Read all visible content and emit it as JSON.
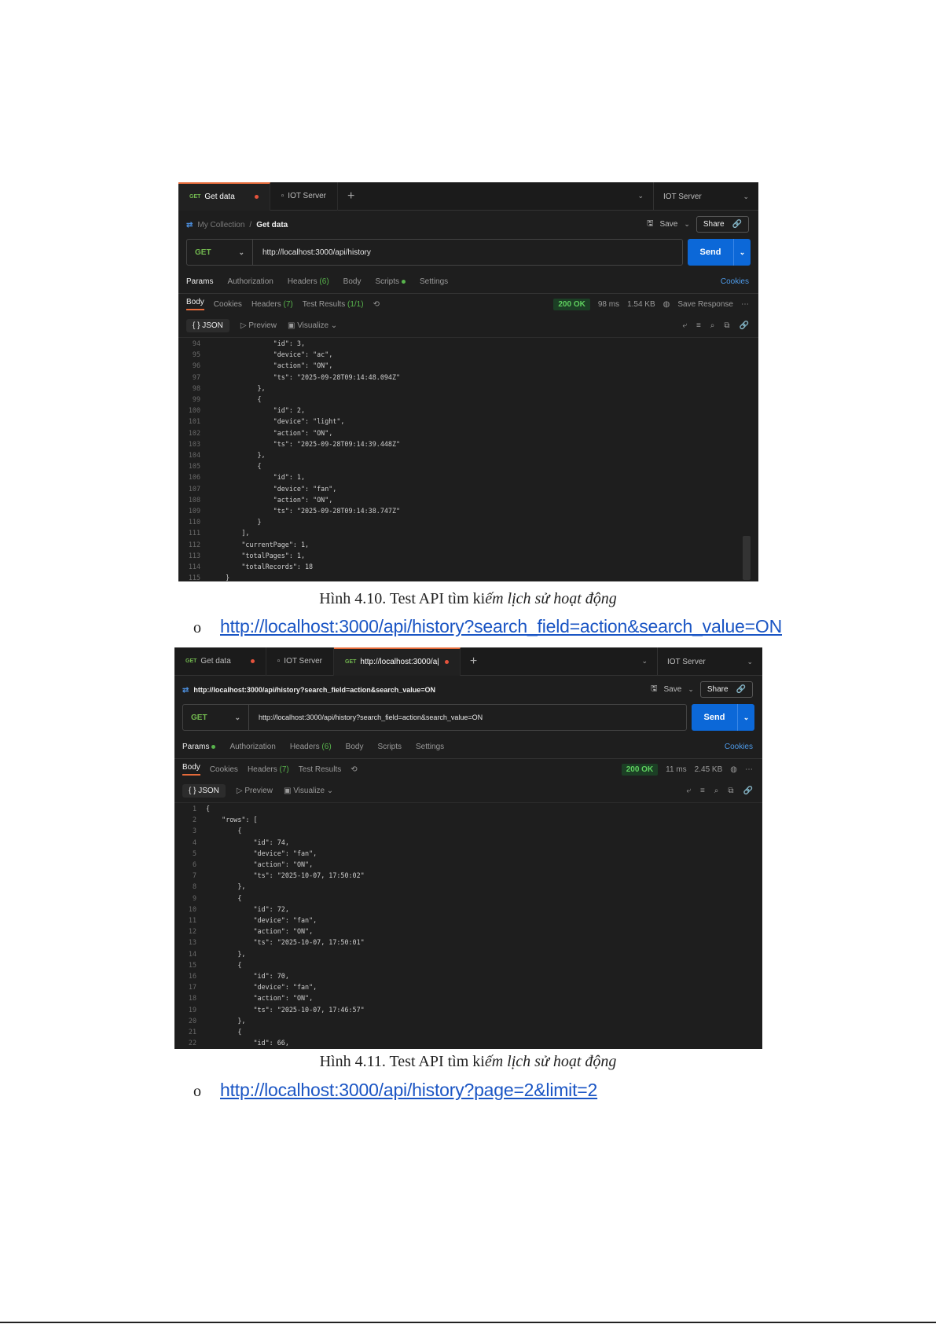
{
  "screenshot1": {
    "tabs": {
      "tab1_method": "GET",
      "tab1_label": "Get data",
      "tab2_label": "IOT Server",
      "env": "IOT Server"
    },
    "crumbs": {
      "collection": "My Collection",
      "separator": "/",
      "request": "Get data"
    },
    "actions": {
      "save": "Save",
      "share": "Share"
    },
    "url": {
      "method": "GET",
      "value": "http://localhost:3000/api/history",
      "send": "Send"
    },
    "reqtabs": {
      "params": "Params",
      "authorization": "Authorization",
      "headers": "Headers",
      "headers_count": "(6)",
      "body": "Body",
      "scripts": "Scripts",
      "settings": "Settings",
      "cookies": "Cookies"
    },
    "restabs": {
      "body": "Body",
      "cookies": "Cookies",
      "headers": "Headers",
      "headers_count": "(7)",
      "tests": "Test Results",
      "tests_count": "(1/1)"
    },
    "meta": {
      "status": "200 OK",
      "time": "98 ms",
      "size": "1.54 KB",
      "save_response": "Save Response"
    },
    "view": {
      "format": "{ } JSON",
      "preview": "Preview",
      "visualize": "Visualize"
    },
    "code": [
      {
        "n": "94",
        "t": "                \"id\": 3,"
      },
      {
        "n": "95",
        "t": "                \"device\": \"ac\","
      },
      {
        "n": "96",
        "t": "                \"action\": \"ON\","
      },
      {
        "n": "97",
        "t": "                \"ts\": \"2025-09-28T09:14:48.094Z\""
      },
      {
        "n": "98",
        "t": "            },"
      },
      {
        "n": "99",
        "t": "            {"
      },
      {
        "n": "100",
        "t": "                \"id\": 2,"
      },
      {
        "n": "101",
        "t": "                \"device\": \"light\","
      },
      {
        "n": "102",
        "t": "                \"action\": \"ON\","
      },
      {
        "n": "103",
        "t": "                \"ts\": \"2025-09-28T09:14:39.448Z\""
      },
      {
        "n": "104",
        "t": "            },"
      },
      {
        "n": "105",
        "t": "            {"
      },
      {
        "n": "106",
        "t": "                \"id\": 1,"
      },
      {
        "n": "107",
        "t": "                \"device\": \"fan\","
      },
      {
        "n": "108",
        "t": "                \"action\": \"ON\","
      },
      {
        "n": "109",
        "t": "                \"ts\": \"2025-09-28T09:14:38.747Z\""
      },
      {
        "n": "110",
        "t": "            }"
      },
      {
        "n": "111",
        "t": "        ],"
      },
      {
        "n": "112",
        "t": "        \"currentPage\": 1,"
      },
      {
        "n": "113",
        "t": "        \"totalPages\": 1,"
      },
      {
        "n": "114",
        "t": "        \"totalRecords\": 18"
      },
      {
        "n": "115",
        "t": "    }"
      }
    ]
  },
  "caption1": {
    "prefix": "Hình 4.10. Test API tìm ki",
    "italic": "ếm lịch sử hoạt động"
  },
  "link1": {
    "bullet": "o",
    "text": "http://localhost:3000/api/history?search_field=action&search_value=ON"
  },
  "screenshot2": {
    "tabs": {
      "tab1_method": "GET",
      "tab1_label": "Get data",
      "tab2_label": "IOT Server",
      "tab3_method": "GET",
      "tab3_label": "http://localhost:3000/a|",
      "env": "IOT Server"
    },
    "crumbs": {
      "request": "http://localhost:3000/api/history?search_field=action&search_value=ON"
    },
    "actions": {
      "save": "Save",
      "share": "Share"
    },
    "url": {
      "method": "GET",
      "value": "http://localhost:3000/api/history?search_field=action&search_value=ON",
      "send": "Send"
    },
    "reqtabs": {
      "params": "Params",
      "authorization": "Authorization",
      "headers": "Headers",
      "headers_count": "(6)",
      "body": "Body",
      "scripts": "Scripts",
      "settings": "Settings",
      "cookies": "Cookies"
    },
    "restabs": {
      "body": "Body",
      "cookies": "Cookies",
      "headers": "Headers",
      "headers_count": "(7)",
      "tests": "Test Results"
    },
    "meta": {
      "status": "200 OK",
      "time": "11 ms",
      "size": "2.45 KB"
    },
    "view": {
      "format": "{ } JSON",
      "preview": "Preview",
      "visualize": "Visualize"
    },
    "code": [
      {
        "n": "1",
        "t": "{"
      },
      {
        "n": "2",
        "t": "    \"rows\": ["
      },
      {
        "n": "3",
        "t": "        {"
      },
      {
        "n": "4",
        "t": "            \"id\": 74,"
      },
      {
        "n": "5",
        "t": "            \"device\": \"fan\","
      },
      {
        "n": "6",
        "t": "            \"action\": \"ON\","
      },
      {
        "n": "7",
        "t": "            \"ts\": \"2025-10-07, 17:50:02\""
      },
      {
        "n": "8",
        "t": "        },"
      },
      {
        "n": "9",
        "t": "        {"
      },
      {
        "n": "10",
        "t": "            \"id\": 72,"
      },
      {
        "n": "11",
        "t": "            \"device\": \"fan\","
      },
      {
        "n": "12",
        "t": "            \"action\": \"ON\","
      },
      {
        "n": "13",
        "t": "            \"ts\": \"2025-10-07, 17:50:01\""
      },
      {
        "n": "14",
        "t": "        },"
      },
      {
        "n": "15",
        "t": "        {"
      },
      {
        "n": "16",
        "t": "            \"id\": 70,"
      },
      {
        "n": "17",
        "t": "            \"device\": \"fan\","
      },
      {
        "n": "18",
        "t": "            \"action\": \"ON\","
      },
      {
        "n": "19",
        "t": "            \"ts\": \"2025-10-07, 17:46:57\""
      },
      {
        "n": "20",
        "t": "        },"
      },
      {
        "n": "21",
        "t": "        {"
      },
      {
        "n": "22",
        "t": "            \"id\": 66,"
      }
    ]
  },
  "caption2": {
    "prefix": "Hình 4.11. Test API tìm ki",
    "italic": "ếm lịch sử hoạt động"
  },
  "link2": {
    "bullet": "o",
    "text": "http://localhost:3000/api/history?page=2&limit=2"
  }
}
